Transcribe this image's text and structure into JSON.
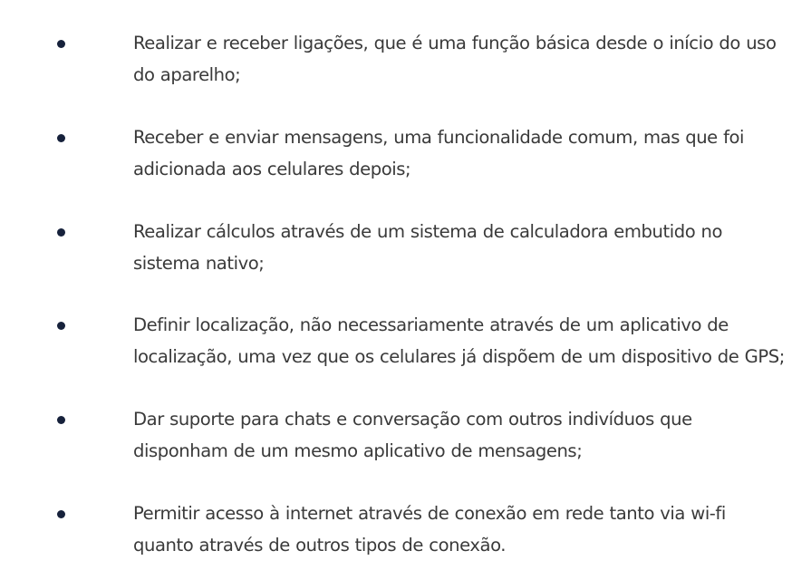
{
  "list": {
    "items": [
      {
        "line1": "Realizar e receber ligações, que é uma função básica desde o início do uso",
        "line2": "do aparelho;"
      },
      {
        "line1": "Receber e enviar mensagens, uma funcionalidade comum, mas que foi",
        "line2": "adicionada aos celulares depois;"
      },
      {
        "line1": "Realizar cálculos através de um sistema de calculadora embutido no",
        "line2": "sistema nativo;"
      },
      {
        "line1": "Definir localização, não necessariamente através de um aplicativo de",
        "line2": "localização, uma vez que os celulares já dispõem de um dispositivo de GPS;"
      },
      {
        "line1": "Dar suporte para chats e conversação com outros indivíduos que",
        "line2": "disponham de um mesmo aplicativo de mensagens;"
      },
      {
        "line1": "Permitir acesso à internet através de conexão em rede tanto via wi-fi",
        "line2": "quanto através de outros tipos de conexão."
      }
    ]
  }
}
